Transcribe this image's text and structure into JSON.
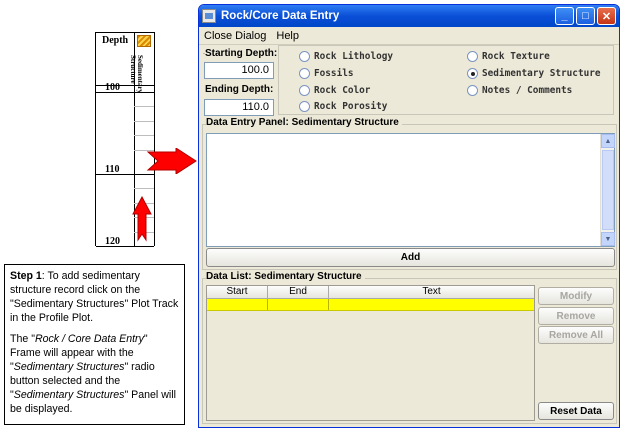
{
  "plot": {
    "depth_label": "Depth",
    "track_label_line1": "Sedimentary",
    "track_label_line2": "Structure",
    "tick_labels": [
      "100",
      "110",
      "120"
    ]
  },
  "step": {
    "heading": "Step 1",
    "para1": ": To add sedimentary structure record click on the \"Sedimentary Structures\" Plot Track in the Profile Plot.",
    "para2_a": "The \"",
    "para2_b": "Rock / Core Data Entry",
    "para2_c": "\" Frame will appear with the \"",
    "para2_d": "Sedimentary Structures",
    "para2_e": "\" radio button selected and the \"",
    "para2_f": "Sedimentary Structures",
    "para2_g": "\" Panel will be displayed."
  },
  "window": {
    "title": "Rock/Core Data Entry",
    "menu": [
      "Close Dialog",
      "Help"
    ],
    "starting_depth_label": "Starting Depth:",
    "starting_depth_value": "100.0",
    "ending_depth_label": "Ending Depth:",
    "ending_depth_value": "110.0",
    "radios": [
      {
        "label": "Rock Lithology",
        "selected": false
      },
      {
        "label": "Fossils",
        "selected": false
      },
      {
        "label": "Rock Color",
        "selected": false
      },
      {
        "label": "Rock Porosity",
        "selected": false
      },
      {
        "label": "Rock Texture",
        "selected": false
      },
      {
        "label": "Sedimentary Structure",
        "selected": true
      },
      {
        "label": "Notes / Comments",
        "selected": false
      }
    ],
    "entry_panel_label": "Data Entry Panel: Sedimentary Structure",
    "add_label": "Add",
    "list_label": "Data List: Sedimentary Structure",
    "columns": [
      "Start",
      "End",
      "Text"
    ],
    "buttons": {
      "modify": "Modify",
      "remove": "Remove",
      "remove_all": "Remove All",
      "reset": "Reset Data"
    }
  },
  "colors": {
    "titlebar": "#0a4fd6",
    "selected_row": "#ffff00",
    "arrow": "#ff0000"
  }
}
